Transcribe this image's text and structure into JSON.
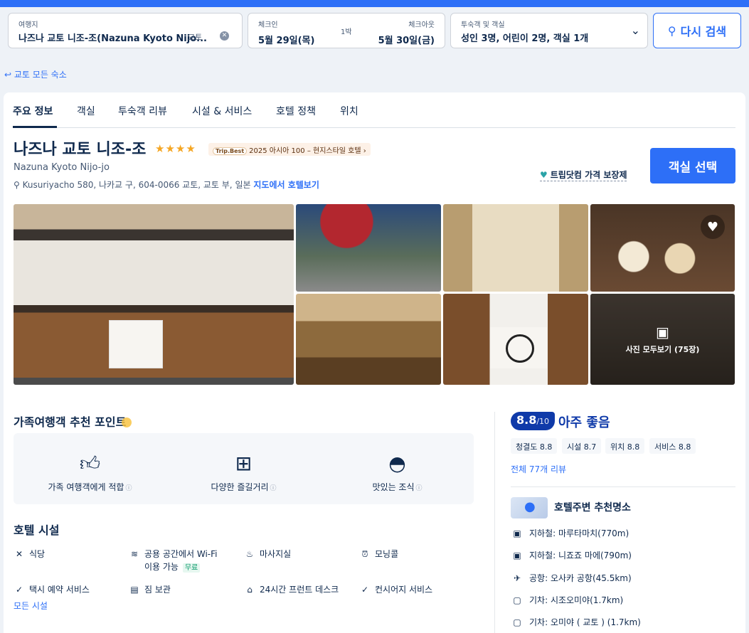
{
  "search": {
    "destination_label": "여행지",
    "destination_value": "나즈나 교토 니조-조(Nazuna Kyoto Nijo...",
    "destination_city": "교토",
    "checkin_label": "체크인",
    "checkout_label": "체크아웃",
    "checkin_value": "5월 29일(목)",
    "checkout_value": "5월 30일(금)",
    "nights": "1박",
    "guests_label": "투숙객 및 객실",
    "guests_value": "성인 3명, 어린이 2명, 객실 1개",
    "search_button": "다시 검색"
  },
  "back_link": "교토 모든 숙소",
  "tabs": [
    "주요 정보",
    "객실",
    "투숙객 리뷰",
    "시설 & 서비스",
    "호텔 정책",
    "위치"
  ],
  "hotel": {
    "name": "나즈나 교토 니조-조",
    "english_name": "Nazuna Kyoto Nijo-jo",
    "stars": "★★★★",
    "badge_brand": "Trip.Best",
    "badge_text": "2025 아시아 100 – 현지스타일 호텔",
    "address": "Kusuriyacho 580, 나카교 구, 604-0066 교토, 교토 부, 일본",
    "map_link": "지도에서 호텔보기",
    "guarantee": "트립닷컴 가격 보장제",
    "select_room": "객실 선택"
  },
  "gallery": {
    "all_photos": "사진 모두보기 (75장)"
  },
  "family": {
    "title": "가족여행객 추천 포인트",
    "items": [
      {
        "label": "가족 여행객에게 적합",
        "icon": "thumbs-up-icon"
      },
      {
        "label": "다양한 즐길거리",
        "icon": "grid-icon"
      },
      {
        "label": "맛있는 조식",
        "icon": "cloche-icon"
      }
    ]
  },
  "facilities": {
    "title": "호텔 시설",
    "items": [
      {
        "label": "식당",
        "icon": "utensils-icon"
      },
      {
        "label": "공용 공간에서 Wi-Fi",
        "label2": "이용 가능",
        "free": "무료",
        "icon": "wifi-icon"
      },
      {
        "label": "마사지실",
        "icon": "massage-icon"
      },
      {
        "label": "모닝콜",
        "icon": "alarm-icon"
      },
      {
        "label": "택시 예약 서비스",
        "icon": "check-circle-icon"
      },
      {
        "label": "짐 보관",
        "icon": "luggage-icon"
      },
      {
        "label": "24시간 프런트 데스크",
        "icon": "front-desk-icon"
      },
      {
        "label": "컨시어지 서비스",
        "icon": "check-circle-icon"
      }
    ],
    "all_link": "모든 시설"
  },
  "rating": {
    "score": "8.8",
    "out_of": "/10",
    "label": "아주 좋음",
    "subs": [
      "청결도 8.8",
      "시설 8.7",
      "위치 8.8",
      "서비스 8.8"
    ],
    "all_reviews": "전체 77개 리뷰"
  },
  "nearby": {
    "title": "호텔주변 추천명소",
    "items": [
      {
        "label": "지하철: 마루타마치(770m)",
        "icon": "subway-icon"
      },
      {
        "label": "지하철: 니죠죠 마에(790m)",
        "icon": "subway-icon"
      },
      {
        "label": "공항: 오사카 공항(45.5km)",
        "icon": "plane-icon"
      },
      {
        "label": "기차: 시조오미야(1.7km)",
        "icon": "train-icon"
      },
      {
        "label": "기차: 오미야 ( 교토 ) (1.7km)",
        "icon": "train-icon"
      }
    ]
  },
  "colors": {
    "accent": "#2d6ff7",
    "navy": "#0f294d",
    "score": "#0f3aa9"
  }
}
